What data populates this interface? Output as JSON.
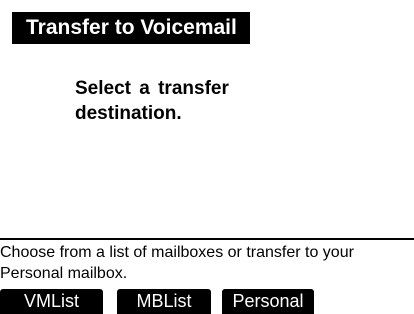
{
  "header": {
    "title": "Transfer to Voicemail"
  },
  "main": {
    "prompt": "Select a transfer destination."
  },
  "footer": {
    "hint": "Choose from a list of mailboxes or transfer to your Personal mailbox."
  },
  "softkeys": [
    {
      "label": "VMList"
    },
    {
      "label": "MBList"
    },
    {
      "label": "Personal"
    }
  ],
  "colors": {
    "background": "#ffffff",
    "foreground": "#000000"
  }
}
